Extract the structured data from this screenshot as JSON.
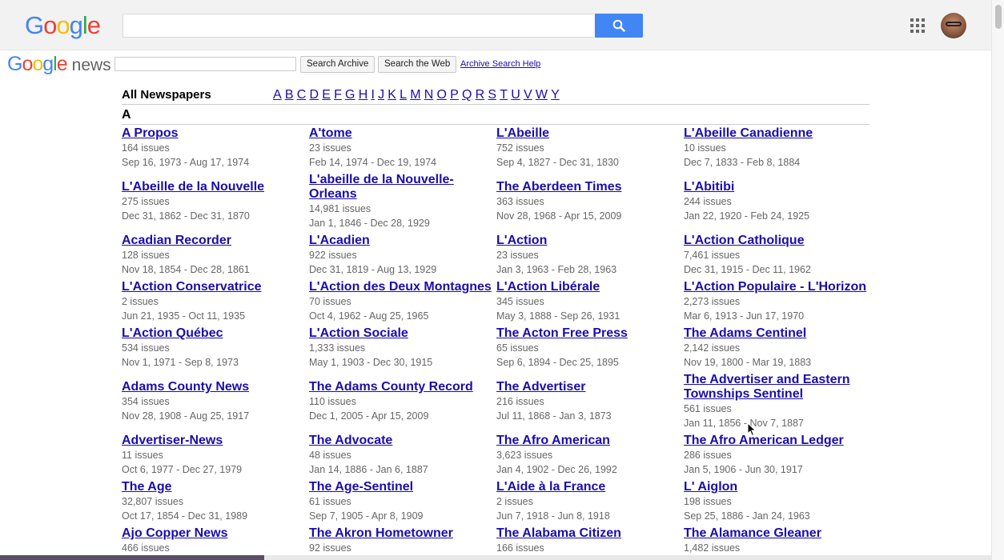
{
  "google_bar": {
    "logo_letters": [
      {
        "ch": "G",
        "color": "#4285f4"
      },
      {
        "ch": "o",
        "color": "#ea4335"
      },
      {
        "ch": "o",
        "color": "#fbbc05"
      },
      {
        "ch": "g",
        "color": "#4285f4"
      },
      {
        "ch": "l",
        "color": "#34a853"
      },
      {
        "ch": "e",
        "color": "#ea4335"
      }
    ],
    "search_value": "",
    "search_icon": "search-icon",
    "apps_icon": "apps-grid-icon",
    "avatar_icon": "user-avatar"
  },
  "news_header": {
    "logo_word": "Google",
    "news_word": "news",
    "archive_search_value": "",
    "search_archive_label": "Search Archive",
    "search_web_label": "Search the Web",
    "help_label": "Archive Search Help"
  },
  "heading": "All Newspapers",
  "letters": [
    "A",
    "B",
    "C",
    "D",
    "E",
    "F",
    "G",
    "H",
    "I",
    "J",
    "K",
    "L",
    "M",
    "N",
    "O",
    "P",
    "Q",
    "R",
    "S",
    "T",
    "U",
    "V",
    "W",
    "Y"
  ],
  "section_letter": "A",
  "rows": [
    [
      {
        "title": "A Propos",
        "issues": "164 issues",
        "range": "Sep 16, 1973 - Aug 17, 1974"
      },
      {
        "title": "A'tome",
        "issues": "23 issues",
        "range": "Feb 14, 1974 - Dec 19, 1974"
      },
      {
        "title": "L'Abeille",
        "issues": "752 issues",
        "range": "Sep 4, 1827 - Dec 31, 1830"
      },
      {
        "title": "L'Abeille Canadienne",
        "issues": "10 issues",
        "range": "Dec 7, 1833 - Feb 8, 1884"
      }
    ],
    [
      {
        "title": "L'Abeille de la Nouvelle",
        "issues": "275 issues",
        "range": "Dec 31, 1862 - Dec 31, 1870"
      },
      {
        "title": "L'abeille de la Nouvelle-Orleans",
        "issues": "14,981 issues",
        "range": "Jan 1, 1846 - Dec 28, 1929"
      },
      {
        "title": "The Aberdeen Times",
        "issues": "363 issues",
        "range": "Nov 28, 1968 - Apr 15, 2009"
      },
      {
        "title": "L'Abitibi",
        "issues": "244 issues",
        "range": "Jan 22, 1920 - Feb 24, 1925"
      }
    ],
    [
      {
        "title": "Acadian Recorder",
        "issues": "128 issues",
        "range": "Nov 18, 1854 - Dec 28, 1861"
      },
      {
        "title": "L'Acadien",
        "issues": "922 issues",
        "range": "Dec 31, 1819 - Aug 13, 1929"
      },
      {
        "title": "L'Action",
        "issues": "23 issues",
        "range": "Jan 3, 1963 - Feb 28, 1963"
      },
      {
        "title": "L'Action Catholique",
        "issues": "7,461 issues",
        "range": "Dec 31, 1915 - Dec 11, 1962"
      }
    ],
    [
      {
        "title": "L'Action Conservatrice",
        "issues": "2 issues",
        "range": "Jun 21, 1935 - Oct 11, 1935"
      },
      {
        "title": "L'Action des Deux Montagnes",
        "issues": "70 issues",
        "range": "Oct 4, 1962 - Aug 25, 1965"
      },
      {
        "title": "L'Action Libérale",
        "issues": "345 issues",
        "range": "May 3, 1888 - Sep 26, 1931"
      },
      {
        "title": "L'Action Populaire - L'Horizon",
        "issues": "2,273 issues",
        "range": "Mar 6, 1913 - Jun 17, 1970"
      }
    ],
    [
      {
        "title": "L'Action Québec",
        "issues": "534 issues",
        "range": "Nov 1, 1971 - Sep 8, 1973"
      },
      {
        "title": "L'Action Sociale",
        "issues": "1,333 issues",
        "range": "May 1, 1903 - Dec 30, 1915"
      },
      {
        "title": "The Acton Free Press",
        "issues": "65 issues",
        "range": "Sep 6, 1894 - Dec 25, 1895"
      },
      {
        "title": "The Adams Centinel",
        "issues": "2,142 issues",
        "range": "Nov 19, 1800 - Mar 19, 1883"
      }
    ],
    [
      {
        "title": "Adams County News",
        "issues": "354 issues",
        "range": "Nov 28, 1908 - Aug 25, 1917"
      },
      {
        "title": "The Adams County Record",
        "issues": "110 issues",
        "range": "Dec 1, 2005 - Apr 15, 2009"
      },
      {
        "title": "The Advertiser",
        "issues": "216 issues",
        "range": "Jul 11, 1868 - Jan 3, 1873"
      },
      {
        "title": "The Advertiser and Eastern Townships Sentinel",
        "issues": "561 issues",
        "range": "Jan 11, 1856 - Nov 7, 1887"
      }
    ],
    [
      {
        "title": "Advertiser-News",
        "issues": "11 issues",
        "range": "Oct 6, 1977 - Dec 27, 1979"
      },
      {
        "title": "The Advocate",
        "issues": "48 issues",
        "range": "Jan 14, 1886 - Jan 6, 1887"
      },
      {
        "title": "The Afro American",
        "issues": "3,623 issues",
        "range": "Jan 4, 1902 - Dec 26, 1992"
      },
      {
        "title": "The Afro American Ledger",
        "issues": "286 issues",
        "range": "Jan 5, 1906 - Jun 30, 1917"
      }
    ],
    [
      {
        "title": "The Age",
        "issues": "32,807 issues",
        "range": "Oct 17, 1854 - Dec 31, 1989"
      },
      {
        "title": "The Age-Sentinel",
        "issues": "61 issues",
        "range": "Sep 7, 1905 - Apr 8, 1909"
      },
      {
        "title": "L'Aide à la France",
        "issues": "2 issues",
        "range": "Jun 7, 1918 - Jun 8, 1918"
      },
      {
        "title": "L' Aiglon",
        "issues": "198 issues",
        "range": "Sep 25, 1886 - Jan 24, 1963"
      }
    ],
    [
      {
        "title": "Ajo Copper News",
        "issues": "466 issues",
        "range": ""
      },
      {
        "title": "The Akron Hometowner",
        "issues": "92 issues",
        "range": ""
      },
      {
        "title": "The Alabama Citizen",
        "issues": "166 issues",
        "range": ""
      },
      {
        "title": "The Alamance Gleaner",
        "issues": "1,482 issues",
        "range": ""
      }
    ]
  ]
}
